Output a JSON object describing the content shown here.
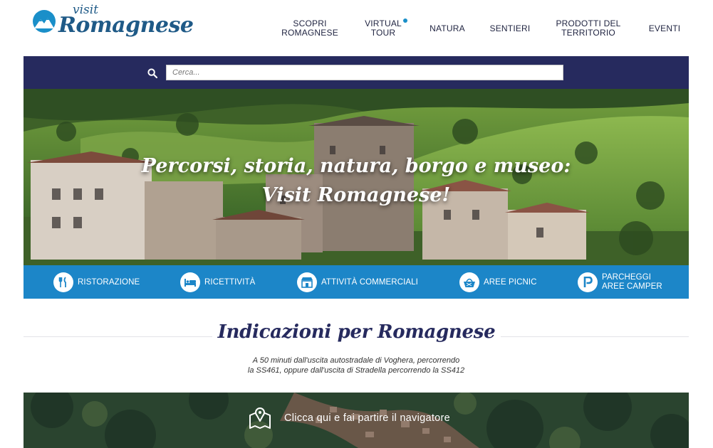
{
  "logo": {
    "visit": "visit",
    "name": "Romagnese"
  },
  "nav": [
    {
      "line1": "SCOPRI",
      "line2": "ROMAGNESE"
    },
    {
      "line1": "VIRTUAL",
      "line2": "TOUR"
    },
    {
      "line1": "NATURA",
      "line2": ""
    },
    {
      "line1": "SENTIERI",
      "line2": ""
    },
    {
      "line1": "PRODOTTI DEL",
      "line2": "TERRITORIO"
    },
    {
      "line1": "EVENTI",
      "line2": ""
    }
  ],
  "search": {
    "placeholder": "Cerca..."
  },
  "hero": {
    "line1": "Percorsi, storia, natura, borgo e museo:",
    "line2": "Visit Romagnese!"
  },
  "categories": [
    {
      "icon": "cutlery-icon",
      "line1": "RISTORAZIONE",
      "line2": ""
    },
    {
      "icon": "bed-icon",
      "line1": "RICETTIVITÀ",
      "line2": ""
    },
    {
      "icon": "shop-icon",
      "line1": "ATTIVITÀ COMMERCIALI",
      "line2": ""
    },
    {
      "icon": "picnic-basket-icon",
      "line1": "AREE PICNIC",
      "line2": ""
    },
    {
      "icon": "parking-icon",
      "line1": "PARCHEGGI",
      "line2": "AREE CAMPER"
    }
  ],
  "directions": {
    "title": "Indicazioni per Romagnese",
    "line1": "A 50 minuti dall'uscita autostradale di Voghera, percorrendo",
    "line2": "la SS461, oppure dall'uscita di Stradella percorrendo la SS412"
  },
  "map": {
    "cta": "Clicca qui e fai partire il navigatore"
  },
  "colors": {
    "navy": "#262a5e",
    "blue": "#1c86c8",
    "logo": "#1f5a87"
  }
}
